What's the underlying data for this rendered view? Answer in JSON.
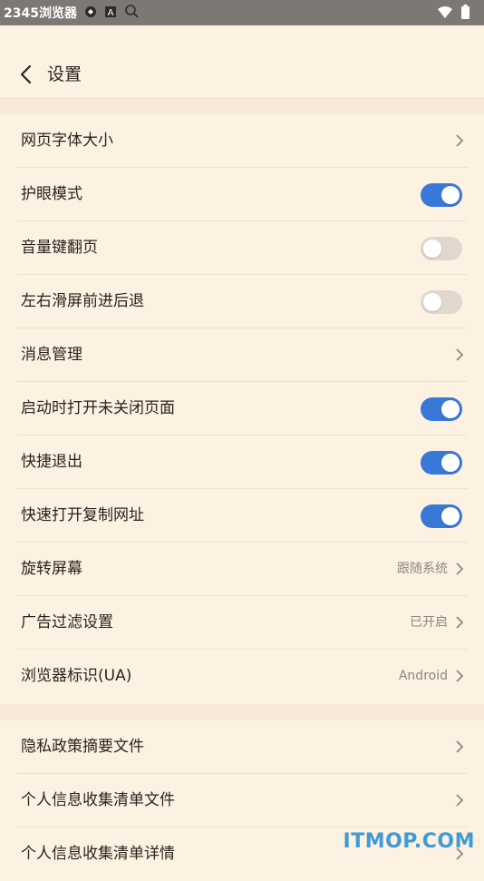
{
  "statusbar": {
    "title": "2345浏览器",
    "icons": [
      "browser-badge-icon",
      "a-icon",
      "search-icon",
      "wifi-icon",
      "battery-icon"
    ]
  },
  "header": {
    "title": "设置",
    "back_icon": "chevron-left-icon"
  },
  "settings_group_1": [
    {
      "label": "网页字体大小",
      "type": "link"
    },
    {
      "label": "护眼模式",
      "type": "toggle",
      "on": true
    },
    {
      "label": "音量键翻页",
      "type": "toggle",
      "on": false
    },
    {
      "label": "左右滑屏前进后退",
      "type": "toggle",
      "on": false
    },
    {
      "label": "消息管理",
      "type": "link"
    },
    {
      "label": "启动时打开未关闭页面",
      "type": "toggle",
      "on": true
    },
    {
      "label": "快捷退出",
      "type": "toggle",
      "on": true
    },
    {
      "label": "快速打开复制网址",
      "type": "toggle",
      "on": true
    },
    {
      "label": "旋转屏幕",
      "type": "link",
      "value": "跟随系统"
    },
    {
      "label": "广告过滤设置",
      "type": "link",
      "value": "已开启"
    },
    {
      "label": "浏览器标识(UA)",
      "type": "link",
      "value": "Android"
    }
  ],
  "settings_group_2": [
    {
      "label": "隐私政策摘要文件",
      "type": "link"
    },
    {
      "label": "个人信息收集清单文件",
      "type": "link"
    },
    {
      "label": "个人信息收集清单详情",
      "type": "link"
    }
  ],
  "watermark": "ITMOP.COM",
  "colors": {
    "background": "#fdf1e2",
    "toggle_on": "#3a78d8",
    "toggle_off": "#e0d8cf",
    "value_text": "#8e877f"
  }
}
